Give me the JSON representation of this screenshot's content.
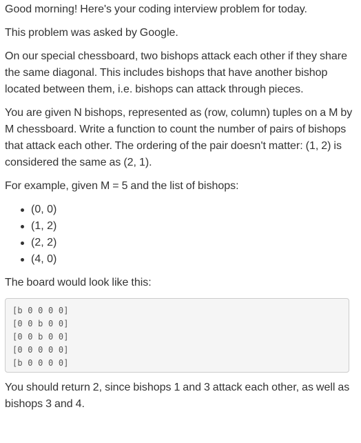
{
  "paragraphs": {
    "greeting": "Good morning! Here's your coding interview problem for today.",
    "source": "This problem was asked by Google.",
    "description": "On our special chessboard, two bishops attack each other if they share the same diagonal. This includes bishops that have another bishop located between them, i.e. bishops can attack through pieces.",
    "task": "You are given N bishops, represented as (row, column) tuples on a M by M chessboard. Write a function to count the number of pairs of bishops that attack each other. The ordering of the pair doesn't matter: (1, 2) is considered the same as (2, 1).",
    "example_intro": "For example, given M = 5 and the list of bishops:",
    "board_intro": "The board would look like this:",
    "answer": "You should return 2, since bishops 1 and 3 attack each other, as well as bishops 3 and 4."
  },
  "bishops": [
    "(0, 0)",
    "(1, 2)",
    "(2, 2)",
    "(4, 0)"
  ],
  "board_rows": [
    "[b 0 0 0 0]",
    "[0 0 b 0 0]",
    "[0 0 b 0 0]",
    "[0 0 0 0 0]",
    "[b 0 0 0 0]"
  ]
}
